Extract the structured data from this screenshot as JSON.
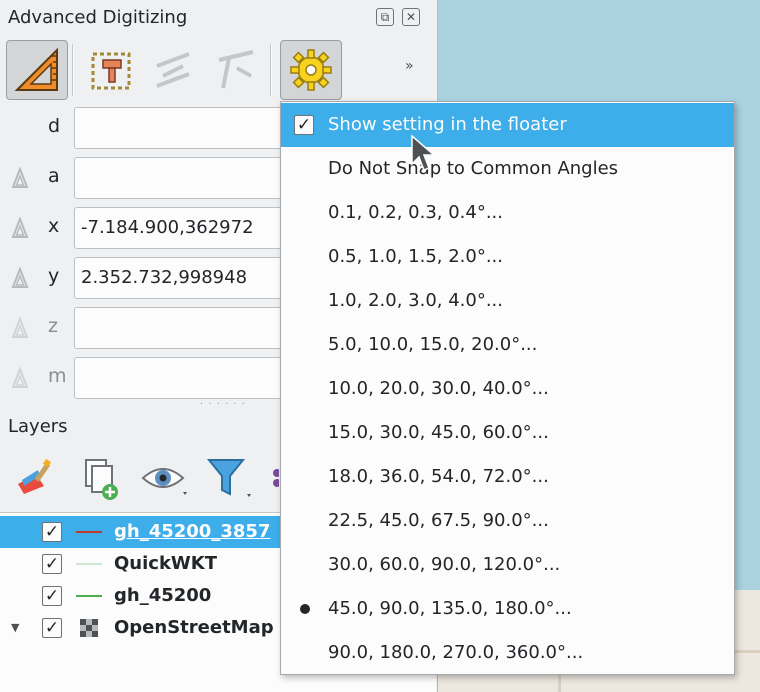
{
  "dock": {
    "title": "Advanced Digitizing",
    "float_icon": "float-icon",
    "close_icon": "close-icon"
  },
  "toolbar": {
    "items": [
      {
        "name": "enable-advanced-digitizing",
        "icon": "set-square-ruler-icon",
        "active": true
      },
      {
        "name": "construction-mode",
        "icon": "construction-frame-icon",
        "active": false
      },
      {
        "name": "parallel",
        "icon": "parallel-lines-icon",
        "enabled": false
      },
      {
        "name": "perpendicular",
        "icon": "perpendicular-icon",
        "enabled": false
      },
      {
        "name": "settings",
        "icon": "gear-icon",
        "active": true
      }
    ],
    "overflow": "»"
  },
  "fields": [
    {
      "label": "d",
      "value": "",
      "lockable": false
    },
    {
      "label": "a",
      "value": "",
      "lockable": true
    },
    {
      "label": "x",
      "value": "-7.184.900,362972",
      "lockable": true
    },
    {
      "label": "y",
      "value": "2.352.732,998948",
      "lockable": true
    },
    {
      "label": "z",
      "value": "",
      "lockable": true,
      "disabled": true
    },
    {
      "label": "m",
      "value": "",
      "lockable": true,
      "disabled": true
    }
  ],
  "layers_panel": {
    "title": "Layers",
    "tools": [
      "style-manager-icon",
      "add-group-icon",
      "visibility-icon",
      "filter-legend-icon"
    ],
    "layers": [
      {
        "name": "gh_45200_3857",
        "checked": true,
        "symbol_color": "#c0392b",
        "selected": true
      },
      {
        "name": "QuickWKT",
        "checked": true,
        "symbol_color": "#cfe7cf",
        "selected": false
      },
      {
        "name": "gh_45200",
        "checked": true,
        "symbol_color": "#4caf50",
        "selected": false
      },
      {
        "name": "OpenStreetMap",
        "checked": true,
        "symbol": "raster-icon",
        "selected": false,
        "expandable": true
      }
    ]
  },
  "menu": {
    "items": [
      {
        "label": "Show setting in the floater",
        "type": "checkbox",
        "checked": true,
        "highlighted": true
      },
      {
        "label": "Do Not Snap to Common Angles",
        "type": "radio",
        "selected": false
      },
      {
        "label": "0.1, 0.2, 0.3, 0.4°...",
        "type": "radio",
        "selected": false
      },
      {
        "label": "0.5, 1.0, 1.5, 2.0°...",
        "type": "radio",
        "selected": false
      },
      {
        "label": "1.0, 2.0, 3.0, 4.0°...",
        "type": "radio",
        "selected": false
      },
      {
        "label": "5.0, 10.0, 15.0, 20.0°...",
        "type": "radio",
        "selected": false
      },
      {
        "label": "10.0, 20.0, 30.0, 40.0°...",
        "type": "radio",
        "selected": false
      },
      {
        "label": "15.0, 30.0, 45.0, 60.0°...",
        "type": "radio",
        "selected": false
      },
      {
        "label": "18.0, 36.0, 54.0, 72.0°...",
        "type": "radio",
        "selected": false
      },
      {
        "label": "22.5, 45.0, 67.5, 90.0°...",
        "type": "radio",
        "selected": false
      },
      {
        "label": "30.0, 60.0, 90.0, 120.0°...",
        "type": "radio",
        "selected": false
      },
      {
        "label": "45.0, 90.0, 135.0, 180.0°...",
        "type": "radio",
        "selected": true
      },
      {
        "label": "90.0, 180.0, 270.0, 360.0°...",
        "type": "radio",
        "selected": false
      }
    ]
  },
  "colors": {
    "highlight": "#3daee9",
    "window_bg": "#eff0f1",
    "map_water": "#aad3df"
  }
}
